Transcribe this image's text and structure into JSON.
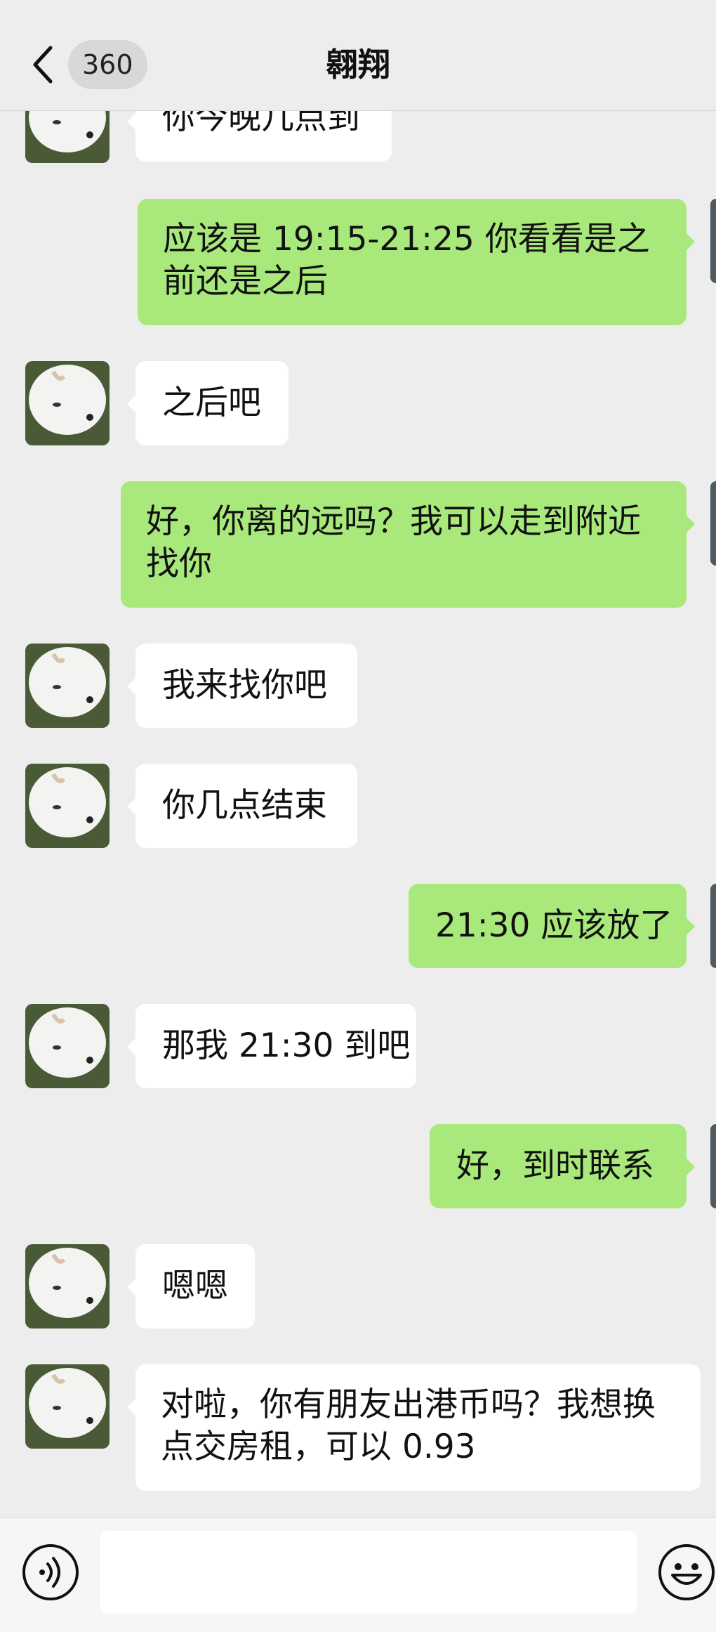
{
  "header": {
    "back_icon": "chevron-left-icon",
    "unread_count": "360",
    "title": "翱翔"
  },
  "messages": [
    {
      "side": "in",
      "text": "你今晚几点到"
    },
    {
      "side": "out",
      "text": "应该是 19:15-21:25 你看看是之前还是之后"
    },
    {
      "side": "in",
      "text": "之后吧"
    },
    {
      "side": "out",
      "text": "好，你离的远吗？我可以走到附近找你"
    },
    {
      "side": "in",
      "text": "我来找你吧"
    },
    {
      "side": "in",
      "text": "你几点结束"
    },
    {
      "side": "out",
      "text": "21:30 应该放了"
    },
    {
      "side": "in",
      "text": "那我 21:30 到吧"
    },
    {
      "side": "out",
      "text": "好，到时联系"
    },
    {
      "side": "in",
      "text": "嗯嗯"
    },
    {
      "side": "in",
      "text": "对啦，你有朋友出港币吗？我想换点交房租，可以 0.93"
    }
  ],
  "input_bar": {
    "voice_icon": "voice-icon",
    "input_value": "",
    "emoji_icon": "emoji-icon"
  },
  "colors": {
    "background": "#ededed",
    "incoming_bubble": "#ffffff",
    "outgoing_bubble": "#a9e97b"
  }
}
